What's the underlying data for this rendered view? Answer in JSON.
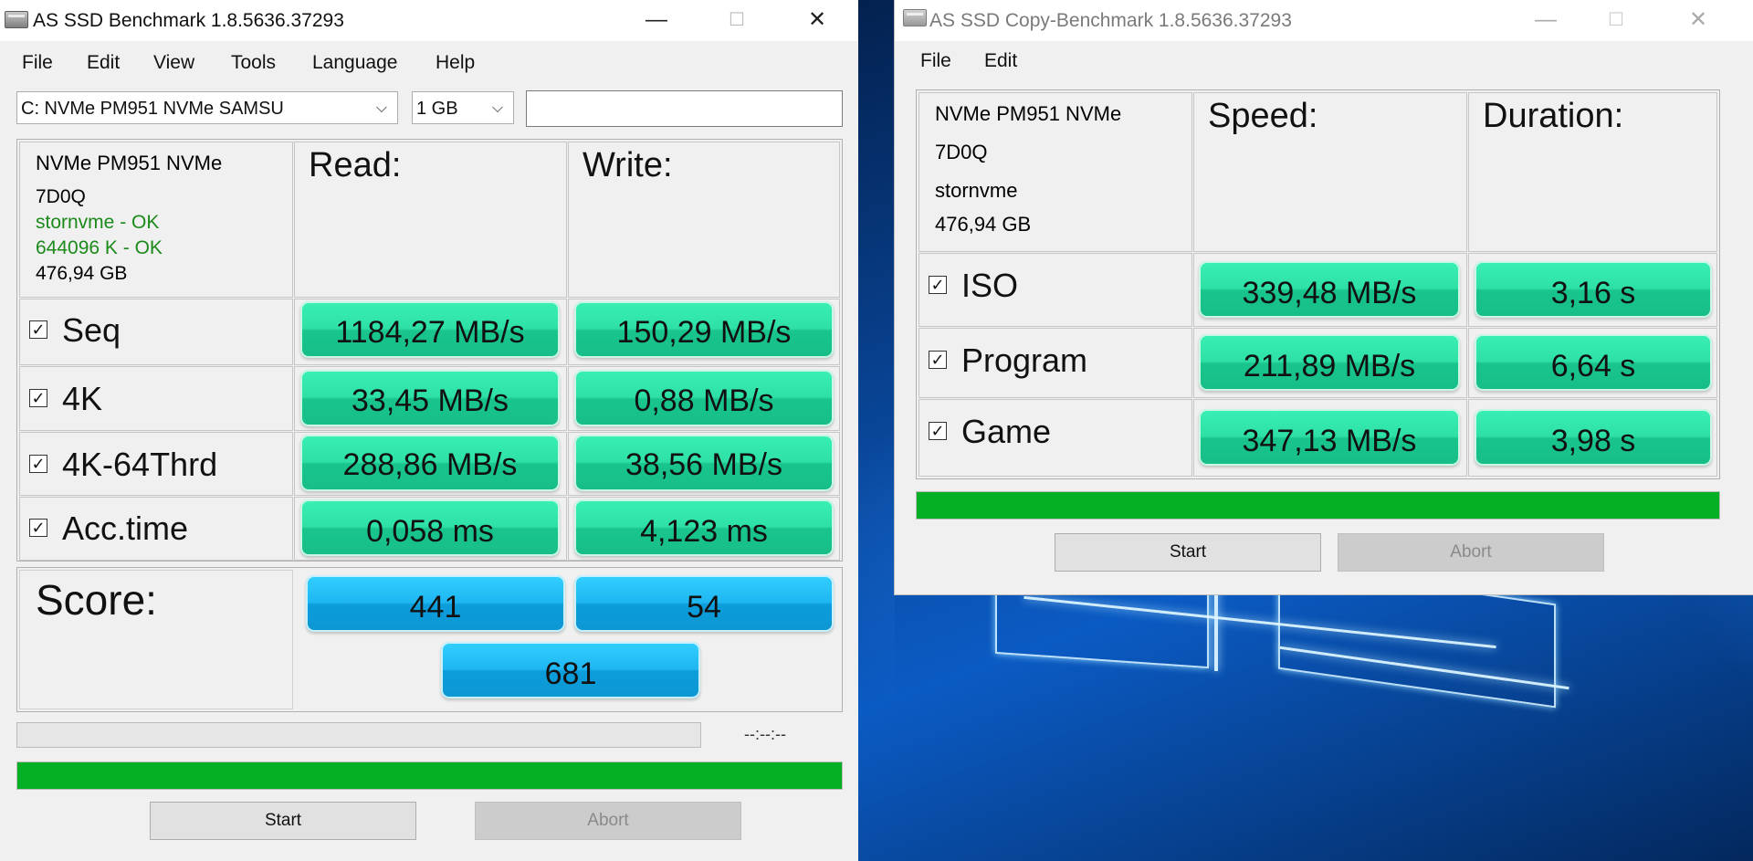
{
  "main_window": {
    "title": "AS SSD Benchmark 1.8.5636.37293",
    "controls": {
      "minimize": "—",
      "maximize": "☐",
      "close": "✕"
    },
    "menu": [
      "File",
      "Edit",
      "View",
      "Tools",
      "Language",
      "Help"
    ],
    "drive_select": "C: NVMe PM951 NVMe SAMSU",
    "size_select": "1 GB",
    "drive_info": {
      "name": "NVMe PM951 NVMe",
      "firmware": "7D0Q",
      "driver": "stornvme - OK",
      "alignment": "644096 K - OK",
      "capacity": "476,94 GB"
    },
    "headers": {
      "read": "Read:",
      "write": "Write:"
    },
    "rows": [
      {
        "label": "Seq",
        "read": "1184,27 MB/s",
        "write": "150,29 MB/s"
      },
      {
        "label": "4K",
        "read": "33,45 MB/s",
        "write": "0,88 MB/s"
      },
      {
        "label": "4K-64Thrd",
        "read": "288,86 MB/s",
        "write": "38,56 MB/s"
      },
      {
        "label": "Acc.time",
        "read": "0,058 ms",
        "write": "4,123 ms"
      }
    ],
    "score": {
      "label": "Score:",
      "read": "441",
      "write": "54",
      "total": "681"
    },
    "timer": "--:--:--",
    "progress_top": 0,
    "progress_bottom": 1,
    "buttons": {
      "start": "Start",
      "abort": "Abort"
    }
  },
  "copy_window": {
    "title": "AS SSD Copy-Benchmark 1.8.5636.37293",
    "controls": {
      "minimize": "—",
      "maximize": "☐",
      "close": "✕"
    },
    "menu": [
      "File",
      "Edit"
    ],
    "drive_info": {
      "name": "NVMe PM951 NVMe",
      "firmware": "7D0Q",
      "driver": "stornvme",
      "capacity": "476,94 GB"
    },
    "headers": {
      "speed": "Speed:",
      "duration": "Duration:"
    },
    "rows": [
      {
        "label": "ISO",
        "speed": "339,48 MB/s",
        "duration": "3,16 s"
      },
      {
        "label": "Program",
        "speed": "211,89 MB/s",
        "duration": "6,64 s"
      },
      {
        "label": "Game",
        "speed": "347,13 MB/s",
        "duration": "3,98 s"
      }
    ],
    "progress": 1,
    "buttons": {
      "start": "Start",
      "abort": "Abort"
    }
  },
  "colors": {
    "result_green": "#2ee0a6",
    "score_blue": "#1fb6f2",
    "progress_green": "#06b025",
    "ok_text": "#1b8a1b"
  }
}
